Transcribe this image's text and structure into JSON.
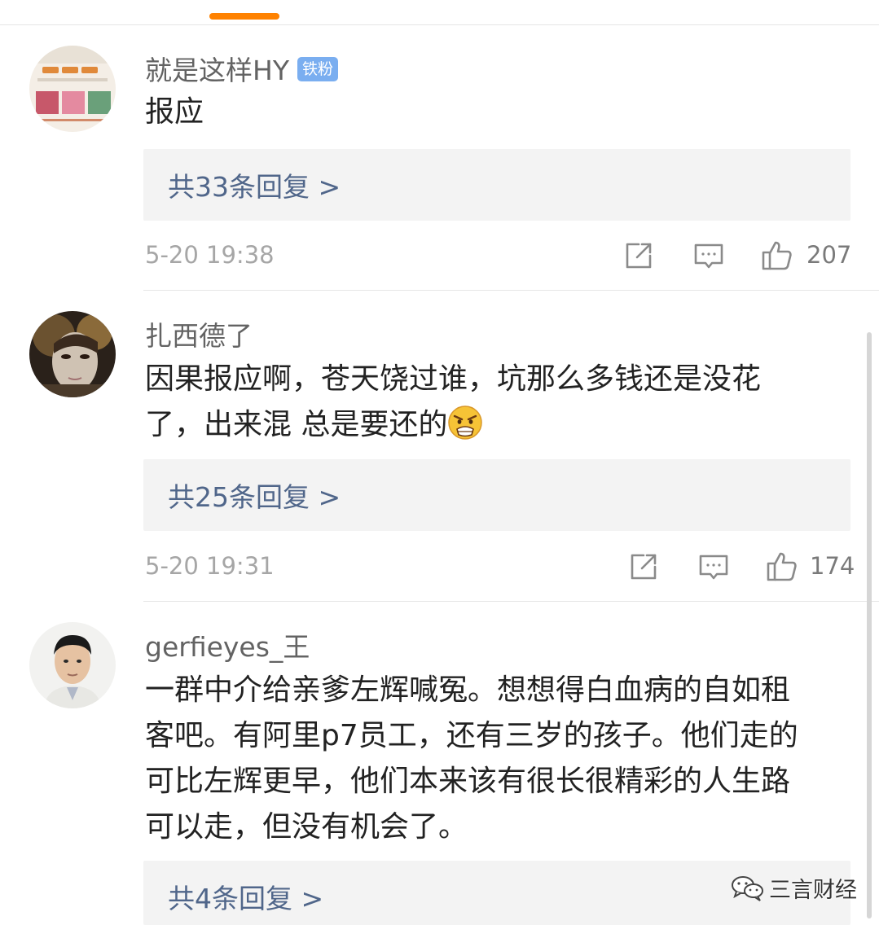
{
  "comments": [
    {
      "username": "就是这样HY",
      "badge": "铁粉",
      "text": "报应",
      "replies_label": "共33条回复 >",
      "timestamp": "5-20 19:38",
      "likes": "207"
    },
    {
      "username": "扎西德了",
      "text_line1": "因果报应啊，苍天饶过谁，坑那么多钱还是没花",
      "text_line2": "了，出来混 总是要还的",
      "replies_label": "共25条回复 >",
      "timestamp": "5-20 19:31",
      "likes": "174"
    },
    {
      "username": "gerfieyes_王",
      "text_lines": [
        "一群中介给亲爹左辉喊冤。想想得白血病的自如租",
        "客吧。有阿里p7员工，还有三岁的孩子。他们走的",
        "可比左辉更早，他们本来该有很长很精彩的人生路",
        "可以走，但没有机会了。"
      ],
      "replies_label": "共4条回复 >"
    }
  ],
  "watermark": {
    "text": "三言财经"
  },
  "colors": {
    "accent": "#ff8200",
    "badge": "#7aaef0",
    "reply_link": "#50668a",
    "reply_bg": "#f3f3f3",
    "meta_text": "#a6a6a6"
  },
  "icons": {
    "repost": "repost-icon",
    "comment": "comment-icon",
    "like": "thumbs-up-icon",
    "emoji": "angry-face-emoji",
    "watermark": "wechat-icon"
  }
}
